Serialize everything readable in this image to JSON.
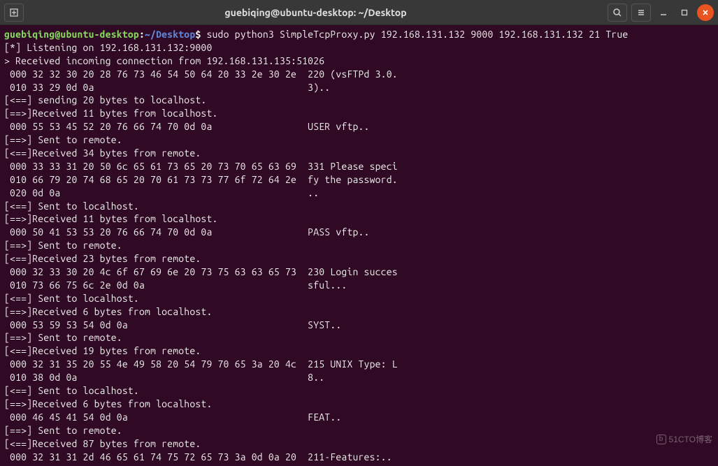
{
  "titlebar": {
    "title": "guebiqing@ubuntu-desktop: ~/Desktop"
  },
  "prompt": {
    "user": "guebiqing@ubuntu-desktop",
    "colon": ":",
    "path": "~/Desktop",
    "dollar": "$",
    "command": " sudo python3 SimpleTcpProxy.py 192.168.131.132 9000 192.168.131.132 21 True"
  },
  "lines": [
    "[*] Listening on 192.168.131.132:9000",
    "> Received incoming connection from 192.168.131.135:51026",
    " 000 32 32 30 20 28 76 73 46 54 50 64 20 33 2e 30 2e  220 (vsFTPd 3.0.",
    " 010 33 29 0d 0a                                      3)..",
    "[<==] sending 20 bytes to localhost.",
    "[==>]Received 11 bytes from localhost.",
    " 000 55 53 45 52 20 76 66 74 70 0d 0a                 USER vftp..",
    "[==>] Sent to remote.",
    "[<==]Received 34 bytes from remote.",
    " 000 33 33 31 20 50 6c 65 61 73 65 20 73 70 65 63 69  331 Please speci",
    " 010 66 79 20 74 68 65 20 70 61 73 73 77 6f 72 64 2e  fy the password.",
    " 020 0d 0a                                            ..",
    "[<==] Sent to localhost.",
    "[==>]Received 11 bytes from localhost.",
    " 000 50 41 53 53 20 76 66 74 70 0d 0a                 PASS vftp..",
    "[==>] Sent to remote.",
    "[<==]Received 23 bytes from remote.",
    " 000 32 33 30 20 4c 6f 67 69 6e 20 73 75 63 63 65 73  230 Login succes",
    " 010 73 66 75 6c 2e 0d 0a                             sful...",
    "[<==] Sent to localhost.",
    "[==>]Received 6 bytes from localhost.",
    " 000 53 59 53 54 0d 0a                                SYST..",
    "[==>] Sent to remote.",
    "[<==]Received 19 bytes from remote.",
    " 000 32 31 35 20 55 4e 49 58 20 54 79 70 65 3a 20 4c  215 UNIX Type: L",
    " 010 38 0d 0a                                         8..",
    "[<==] Sent to localhost.",
    "[==>]Received 6 bytes from localhost.",
    " 000 46 45 41 54 0d 0a                                FEAT..",
    "[==>] Sent to remote.",
    "[<==]Received 87 bytes from remote.",
    " 000 32 31 31 2d 46 65 61 74 75 72 65 73 3a 0d 0a 20  211-Features:.. "
  ],
  "watermark": "51CTO博客"
}
